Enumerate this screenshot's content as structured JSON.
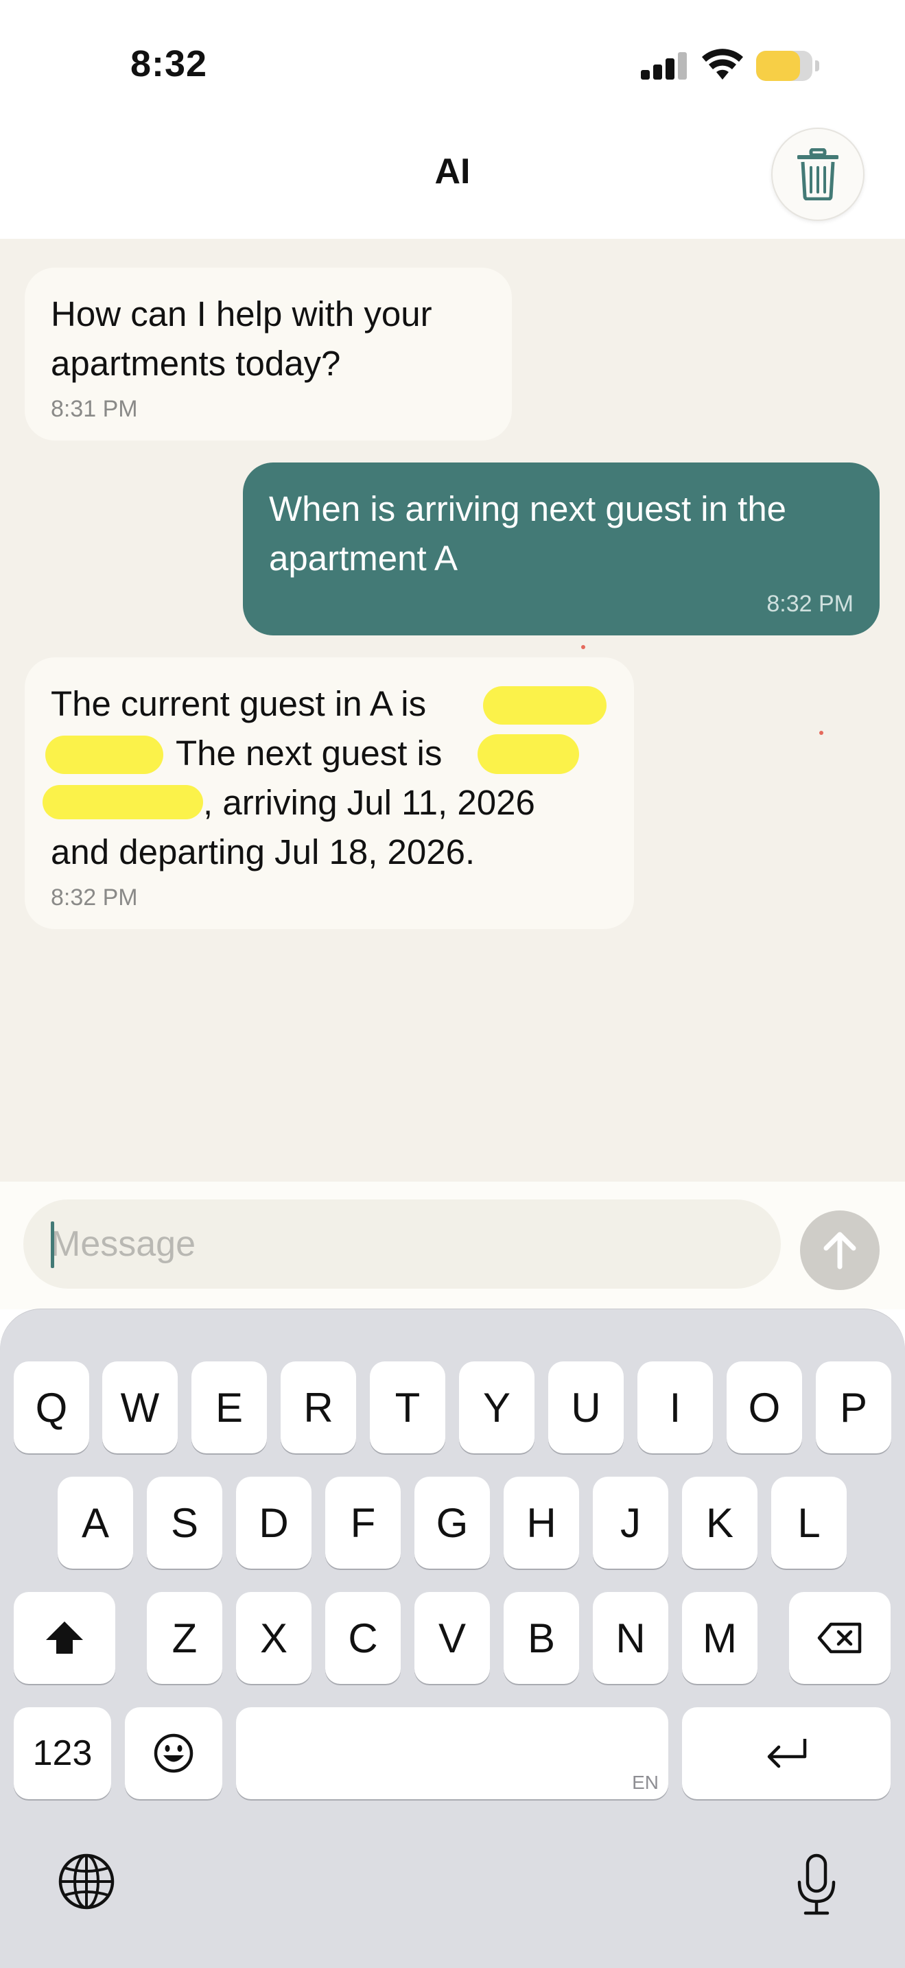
{
  "status_bar": {
    "time": "8:32"
  },
  "header": {
    "title": "AI",
    "trash_icon": "trash-icon"
  },
  "messages": [
    {
      "role": "assistant",
      "text": "How can I help with your apartments today?",
      "line1": "How can I help with your",
      "line2": "apartments today?",
      "time": "8:31 PM"
    },
    {
      "role": "user",
      "text": "When is arriving next guest in the apartment A",
      "line1": "When is arriving next guest in the",
      "line2": "apartment A",
      "time": "8:32 PM"
    },
    {
      "role": "assistant",
      "line1": "The current guest in A is",
      "line2": "The next guest is",
      "line3": ", arriving Jul 11, 2026",
      "line4": "and departing Jul 18, 2026.",
      "time": "8:32 PM"
    }
  ],
  "composer": {
    "placeholder": "Message",
    "send_icon": "arrow-up-icon"
  },
  "keyboard": {
    "row1": [
      "Q",
      "W",
      "E",
      "R",
      "T",
      "Y",
      "U",
      "I",
      "O",
      "P"
    ],
    "row2": [
      "A",
      "S",
      "D",
      "F",
      "G",
      "H",
      "J",
      "K",
      "L"
    ],
    "row3": [
      "Z",
      "X",
      "C",
      "V",
      "B",
      "N",
      "M"
    ],
    "numbers_key": "123",
    "space_lang": "EN",
    "icons": [
      "shift-icon",
      "backspace-icon",
      "emoji-icon",
      "return-icon",
      "globe-icon",
      "microphone-icon"
    ]
  },
  "colors": {
    "accent": "#437a76",
    "chat_bg": "#f4f1ea",
    "bubble_in": "#fbf9f3",
    "redaction": "#fbf24a",
    "battery": "#f7cf46"
  }
}
